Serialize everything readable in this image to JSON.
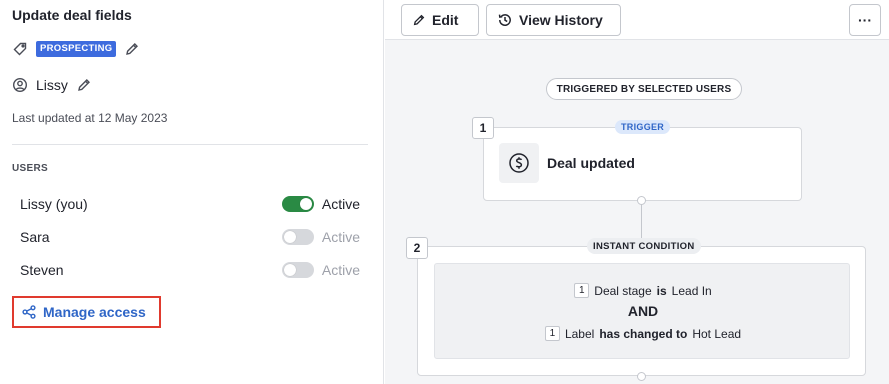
{
  "left_panel": {
    "title": "Update deal fields",
    "tag_label": "PROSPECTING",
    "owner": "Lissy",
    "last_updated": "Last updated at 12 May 2023",
    "users_heading": "USERS",
    "users": [
      {
        "name": "Lissy (you)",
        "status": "Active",
        "enabled": true
      },
      {
        "name": "Sara",
        "status": "Active",
        "enabled": false
      },
      {
        "name": "Steven",
        "status": "Active",
        "enabled": false
      }
    ],
    "manage_access": "Manage access"
  },
  "toolbar": {
    "edit_label": "Edit",
    "history_label": "View History",
    "more_label": "···"
  },
  "flow": {
    "trigger_by": "TRIGGERED BY SELECTED USERS",
    "step1": {
      "number": "1",
      "tag": "TRIGGER",
      "label": "Deal updated"
    },
    "step2": {
      "number": "2",
      "tag": "INSTANT CONDITION",
      "cond1_num": "1",
      "cond1_field": "Deal stage",
      "cond1_op": "is",
      "cond1_value": "Lead In",
      "joiner": "AND",
      "cond2_num": "1",
      "cond2_field": "Label",
      "cond2_op": "has changed to",
      "cond2_value": "Hot Lead"
    }
  },
  "colors": {
    "badge": "#3d6bde",
    "toggle_on": "#2a8a44",
    "link": "#2f66c7",
    "highlight_border": "#e03a2e"
  }
}
